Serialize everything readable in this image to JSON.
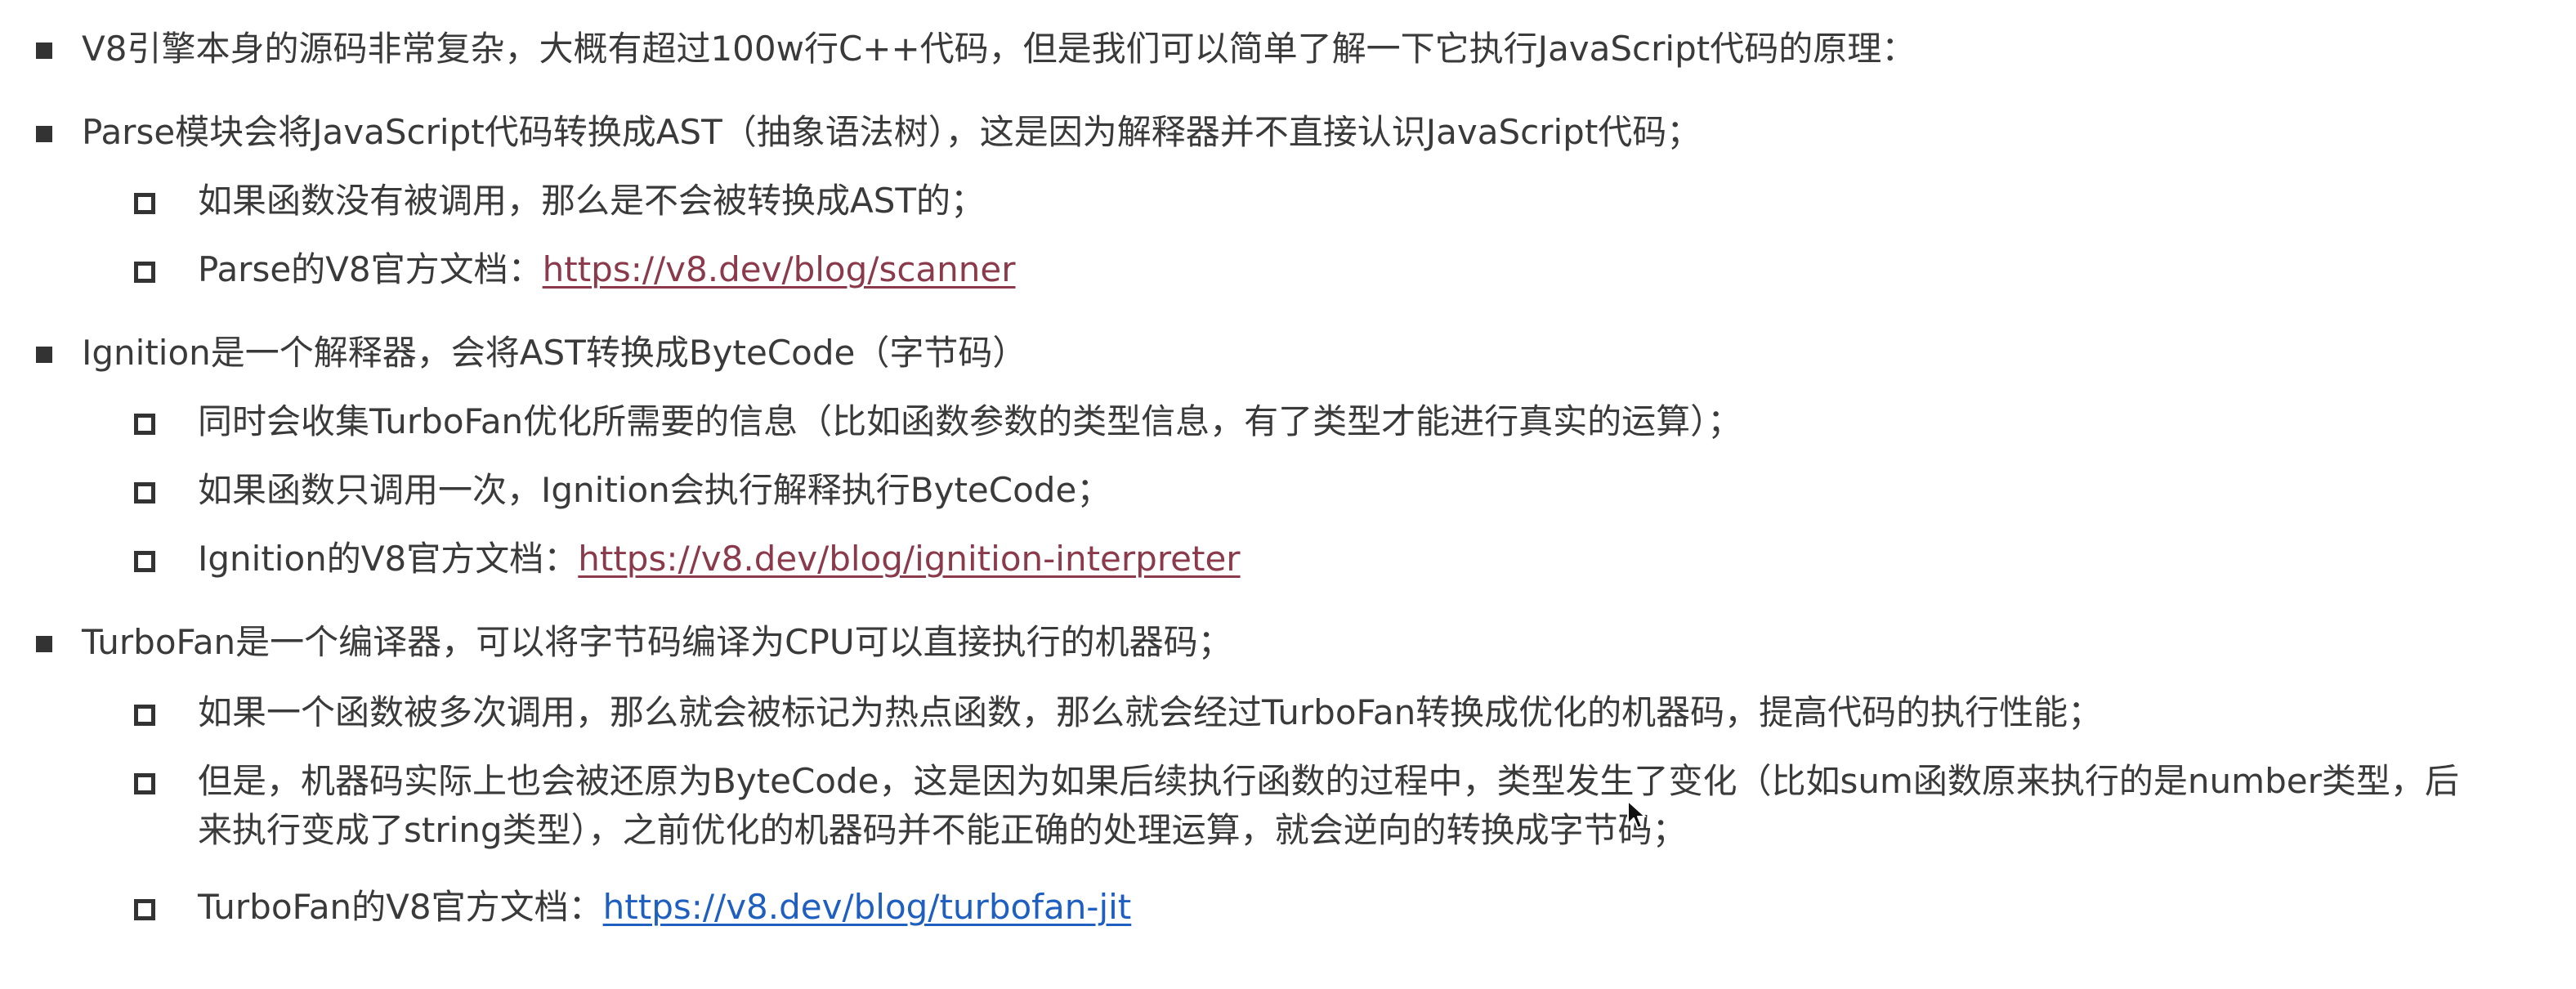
{
  "items": [
    {
      "text": "V8引擎本身的源码非常复杂，大概有超过100w行C++代码，但是我们可以简单了解一下它执行JavaScript代码的原理："
    },
    {
      "text": "Parse模块会将JavaScript代码转换成AST（抽象语法树），这是因为解释器并不直接认识JavaScript代码；"
    },
    {
      "text": "如果函数没有被调用，那么是不会被转换成AST的；"
    },
    {
      "text": "Parse的V8官方文档：",
      "link": "https://v8.dev/blog/scanner"
    },
    {
      "text": "Ignition是一个解释器，会将AST转换成ByteCode（字节码）"
    },
    {
      "text": "同时会收集TurboFan优化所需要的信息（比如函数参数的类型信息，有了类型才能进行真实的运算）；"
    },
    {
      "text": "如果函数只调用一次，Ignition会执行解释执行ByteCode；"
    },
    {
      "text": "Ignition的V8官方文档：",
      "link": "https://v8.dev/blog/ignition-interpreter"
    },
    {
      "text": "TurboFan是一个编译器，可以将字节码编译为CPU可以直接执行的机器码；"
    },
    {
      "text": "如果一个函数被多次调用，那么就会被标记为热点函数，那么就会经过TurboFan转换成优化的机器码，提高代码的执行性能；"
    },
    {
      "text_line1": "但是，机器码实际上也会被还原为ByteCode，这是因为如果后续执行函数的过程中，类型发生了变化（比如sum函数原来执行的是number类型，后",
      "text_line2": "来执行变成了string类型），之前优化的机器码并不能正确的处理运算，就会逆向的转换成字节码；"
    },
    {
      "text": "TurboFan的V8官方文档：",
      "link": "https://v8.dev/blog/turbofan-jit"
    }
  ],
  "colors": {
    "text": "#3a3a3a",
    "link_visited": "#8a3a4b",
    "link": "#1f5fbf",
    "bullet": "#333333"
  },
  "icons": {
    "level1_bullet": "filled-square-bullet-icon",
    "level2_bullet": "hollow-square-bullet-icon",
    "cursor": "mouse-cursor-icon"
  }
}
